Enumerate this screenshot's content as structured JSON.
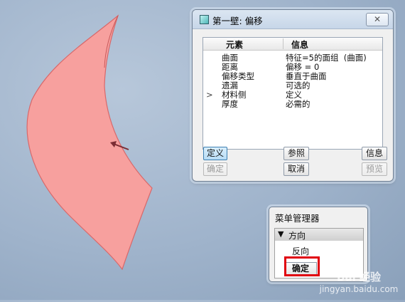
{
  "dialog": {
    "title": "第一壁: 偏移",
    "close": "✕",
    "columns": [
      "元素",
      "信息"
    ],
    "rows": [
      {
        "element": "曲面",
        "info": "特征=5的面组  (曲面)",
        "arrow": ""
      },
      {
        "element": "距离",
        "info": "偏移 = 0",
        "arrow": ""
      },
      {
        "element": "偏移类型",
        "info": "垂直于曲面",
        "arrow": ""
      },
      {
        "element": "遗漏",
        "info": "可选的",
        "arrow": ""
      },
      {
        "element": "材料侧",
        "info": "定义",
        "arrow": ">"
      },
      {
        "element": "厚度",
        "info": "必需的",
        "arrow": ""
      }
    ],
    "buttons": {
      "define": "定义",
      "refs": "参照",
      "info": "信息",
      "ok": "确定",
      "cancel": "取消",
      "preview": "预览"
    }
  },
  "menu": {
    "title": "菜单管理器",
    "section": "方向",
    "item": "反向",
    "ok": "确定"
  },
  "watermark": {
    "brand": "Bai 经验",
    "url": "jingyan.baidu.com"
  },
  "colors": {
    "surface_fill": "#f7a09e",
    "surface_edge": "#d8686a",
    "highlight": "#e0000f"
  }
}
